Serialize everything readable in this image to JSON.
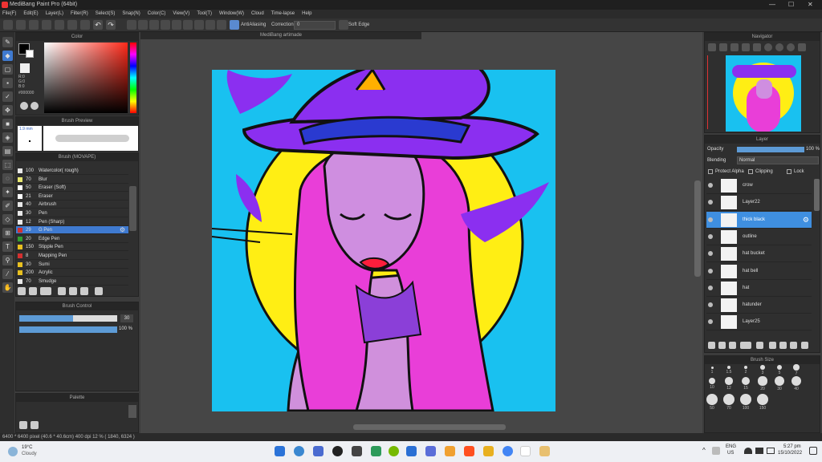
{
  "window": {
    "title": "MediBang Paint Pro (64bit)",
    "controls": [
      "—",
      "☐",
      "✕"
    ]
  },
  "menu": [
    "File(F)",
    "Edit(E)",
    "Layer(L)",
    "Filter(R)",
    "Select(S)",
    "Snap(N)",
    "Color(C)",
    "View(V)",
    "Tool(T)",
    "Window(W)",
    "Cloud",
    "Time-lapse",
    "Help"
  ],
  "toolbar": {
    "antialias": "AntiAliasing",
    "correction": "Correction",
    "correction_value": "0",
    "soft_edge": "Soft Edge"
  },
  "color_panel": {
    "title": "Color",
    "r": "R:0",
    "g": "G:0",
    "b": "B:0",
    "hex": "#000000"
  },
  "brush_preview": {
    "title": "Brush Preview",
    "size": "1.9 mm"
  },
  "brush_list": {
    "title": "Brush (MOVAPE)",
    "items": [
      {
        "size": "100",
        "name": "Watercolor( rough)",
        "color": "#e8e8e8"
      },
      {
        "size": "70",
        "name": "Blur",
        "color": "#e8e870"
      },
      {
        "size": "50",
        "name": "Eraser (Soft)",
        "color": "#ffffff"
      },
      {
        "size": "21",
        "name": "Eraser",
        "color": "#ffffff"
      },
      {
        "size": "40",
        "name": "Airbrush",
        "color": "#e8e8e8"
      },
      {
        "size": "30",
        "name": "Pen",
        "color": "#e8e8e8"
      },
      {
        "size": "12",
        "name": "Pen (Sharp)",
        "color": "#e8e8e8"
      },
      {
        "size": "29",
        "name": "G Pen",
        "color": "#d43030"
      },
      {
        "size": "20",
        "name": "Edge Pen",
        "color": "#30a030"
      },
      {
        "size": "150",
        "name": "Stipple Pen",
        "color": "#e8c020"
      },
      {
        "size": "8",
        "name": "Mapping Pen",
        "color": "#d43030"
      },
      {
        "size": "30",
        "name": "Sumi",
        "color": "#e8c020"
      },
      {
        "size": "200",
        "name": "Acrylic",
        "color": "#e8c020"
      },
      {
        "size": "70",
        "name": "Smudge",
        "color": "#e8e8e8"
      }
    ],
    "selected_index": 7
  },
  "brush_control": {
    "title": "Brush Control",
    "size": "30",
    "opacity": "100 %",
    "size_fill": 0.55,
    "opacity_fill": 1.0
  },
  "palette": {
    "title": "Palette"
  },
  "canvas": {
    "tab": "MediBang artimade"
  },
  "navigator": {
    "title": "Navigator"
  },
  "layer_panel": {
    "title": "Layer",
    "opacity_label": "Opacity",
    "opacity_value": "100 %",
    "blending_label": "Blending",
    "blending_value": "Normal",
    "protect_alpha": "Protect Alpha",
    "clipping": "Clipping",
    "lock": "Lock",
    "layers": [
      {
        "name": "crow",
        "selected": false
      },
      {
        "name": "Layer22",
        "selected": false
      },
      {
        "name": "thick black",
        "selected": true
      },
      {
        "name": "outline",
        "selected": false
      },
      {
        "name": "hat bucket",
        "selected": false
      },
      {
        "name": "hat bell",
        "selected": false
      },
      {
        "name": "hat",
        "selected": false
      },
      {
        "name": "hatunder",
        "selected": false
      },
      {
        "name": "Layer25",
        "selected": false
      }
    ]
  },
  "brush_size": {
    "title": "Brush Size",
    "labels": [
      "1",
      "1.5",
      "2",
      "3",
      "5",
      "7",
      "10",
      "12",
      "15",
      "20",
      "30",
      "40",
      "50",
      "70",
      "100",
      "150"
    ]
  },
  "statusbar": {
    "text": "6400 * 6400 pixel  (40.6 * 40.6cm)  400 dpi  12 %  ( 1840, 6324 )"
  },
  "taskbar": {
    "weather_temp": "19°C",
    "weather_desc": "Cloudy",
    "lang": "ENG",
    "region": "US",
    "time": "5:27 pm",
    "date": "15/10/2022"
  }
}
